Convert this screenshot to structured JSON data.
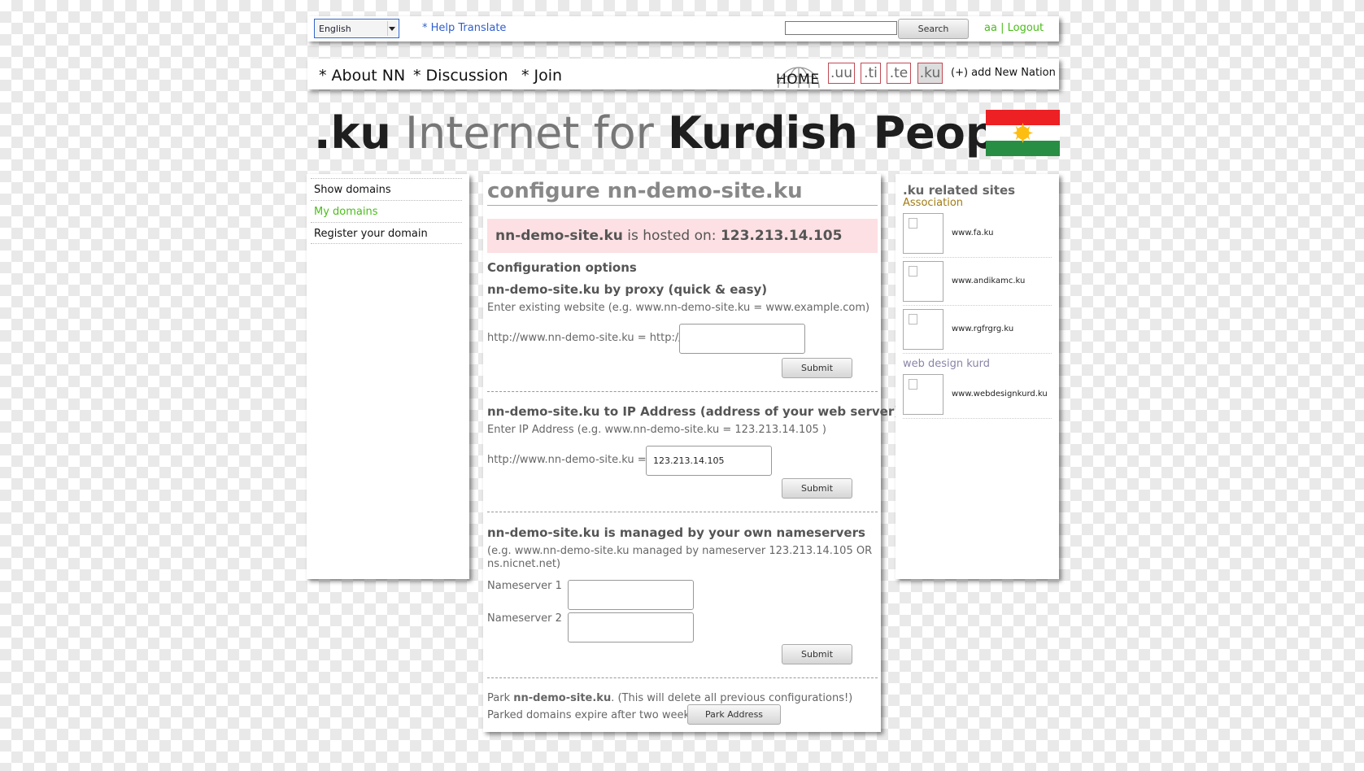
{
  "topbar": {
    "language_selected": "English",
    "help_translate": "* Help Translate",
    "search_button": "Search",
    "user_link": "aa",
    "separator": "|",
    "logout_link": "Logout"
  },
  "nav": {
    "about": "*  About NN",
    "discussion": "*  Discussion",
    "join": "*  Join",
    "home": "HOME",
    "tlds": [
      ".uu",
      ".ti",
      ".te",
      ".ku"
    ],
    "active_tld": ".ku",
    "add_nation": "(+) add New Nation"
  },
  "headline": {
    "tld": ".ku",
    "middle": " Internet for ",
    "people": "Kurdish People"
  },
  "left_menu": {
    "items": [
      "Show domains",
      "My domains",
      "Register your domain"
    ],
    "active_color": "#4bbd1b"
  },
  "main": {
    "title": "configure nn-demo-site.ku",
    "hosted": {
      "domain": "nn-demo-site.ku",
      "text": " is hosted on: ",
      "ip": "123.213.14.105"
    },
    "config_options": "Configuration options",
    "proxy": {
      "heading": "nn-demo-site.ku by proxy (quick & easy)",
      "hint": "Enter existing website (e.g. www.nn-demo-site.ku = www.example.com)",
      "label": "http://www.nn-demo-site.ku = http://",
      "value": "",
      "submit": "Submit"
    },
    "ip": {
      "heading": "nn-demo-site.ku to IP Address (address of your web server)",
      "hint": "Enter IP Address (e.g. www.nn-demo-site.ku = 123.213.14.105 )",
      "label": "http://www.nn-demo-site.ku = ",
      "value": "123.213.14.105",
      "submit": "Submit"
    },
    "ns": {
      "heading": "nn-demo-site.ku is managed by your own nameservers",
      "hint_line1": "(e.g. www.nn-demo-site.ku managed by nameserver 123.213.14.105 OR",
      "hint_line2": "ns.nicnet.net)",
      "ns1_label": "Nameserver 1",
      "ns2_label": "Nameserver 2",
      "ns1_value": "",
      "ns2_value": "",
      "submit": "Submit"
    },
    "park": {
      "prefix": "Park ",
      "domain": "nn-demo-site.ku",
      "suffix": ". (This will delete all previous configurations!)",
      "line2": "Parked domains expire after two weeks.",
      "button": "Park Address"
    }
  },
  "right": {
    "title": ".ku related sites",
    "categories": [
      {
        "name": "Association",
        "color": "#a27a10",
        "sites": [
          "www.fa.ku",
          "www.andikamc.ku",
          "www.rgfrgrg.ku"
        ]
      },
      {
        "name": "web design kurd",
        "color": "#8a84a8",
        "sites": [
          "www.webdesignkurd.ku"
        ]
      }
    ]
  },
  "colors": {
    "flag_red": "#ed2024",
    "flag_white": "#ffffff",
    "flag_green": "#278e43",
    "flag_sun": "#febd11",
    "link_blue": "#2f5fcf",
    "link_green": "#4bbd1b"
  }
}
